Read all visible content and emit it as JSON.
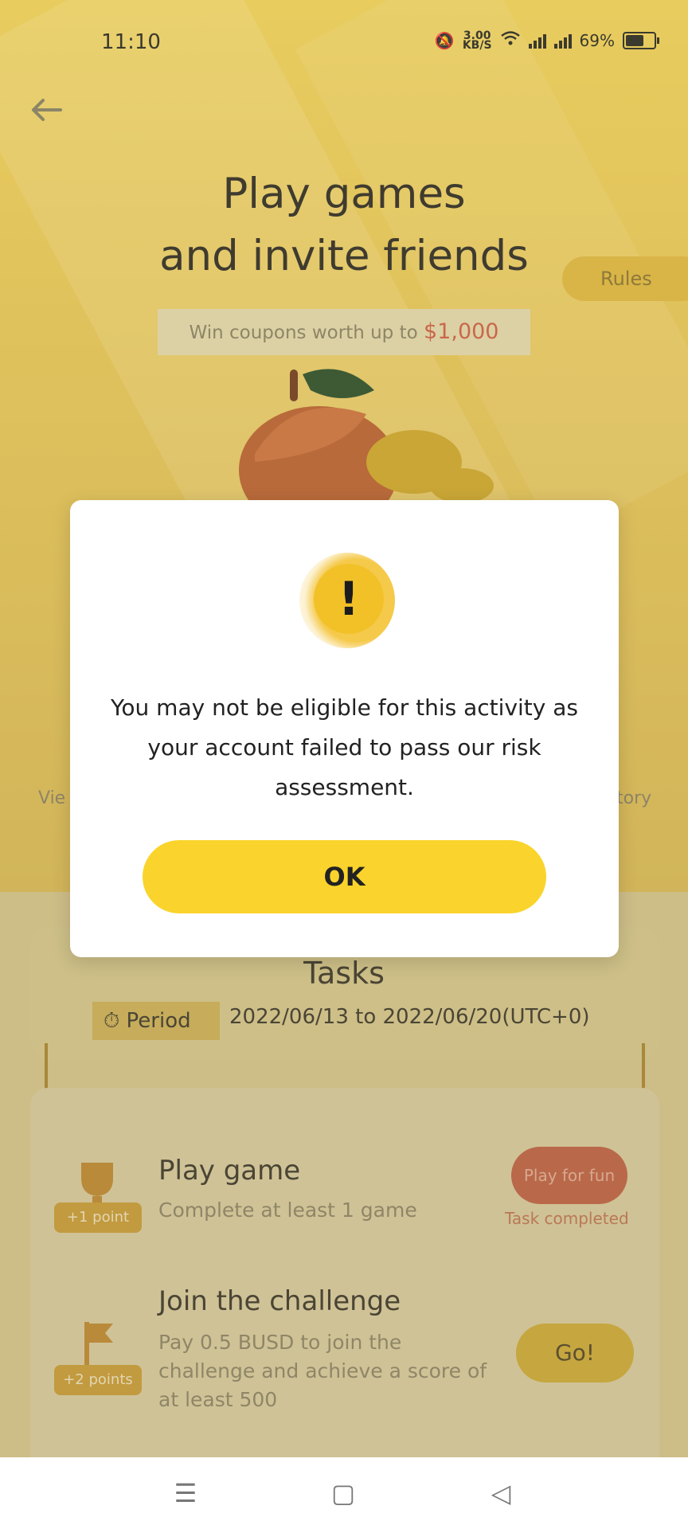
{
  "status_bar": {
    "time": "11:10",
    "speed_value": "3.00",
    "speed_unit": "KB/S",
    "battery": "69%"
  },
  "hero": {
    "title_line1": "Play games",
    "title_line2": "and invite friends",
    "rules_label": "Rules",
    "coupon_text": "Win coupons worth up to",
    "coupon_amount": "$1,000",
    "side_left": "Vie",
    "side_right": "tory"
  },
  "tasks": {
    "title": "Tasks",
    "period_label": "Period",
    "period_range": "2022/06/13 to 2022/06/20(UTC+0)",
    "items": [
      {
        "title": "Play game",
        "desc": "Complete at least 1 game",
        "points": "+1 point",
        "button": "Play for fun",
        "status": "Task completed"
      },
      {
        "title": "Join the challenge",
        "desc": "Pay 0.5 BUSD to join the challenge and achieve a score of at least 500",
        "points": "+2 points",
        "button": "Go!"
      }
    ]
  },
  "modal": {
    "message": "You may not be eligible for this activity as your account failed to pass our risk assessment.",
    "ok_label": "OK"
  },
  "colors": {
    "accent_yellow": "#fad42c",
    "warning_yellow": "#f2c128"
  }
}
